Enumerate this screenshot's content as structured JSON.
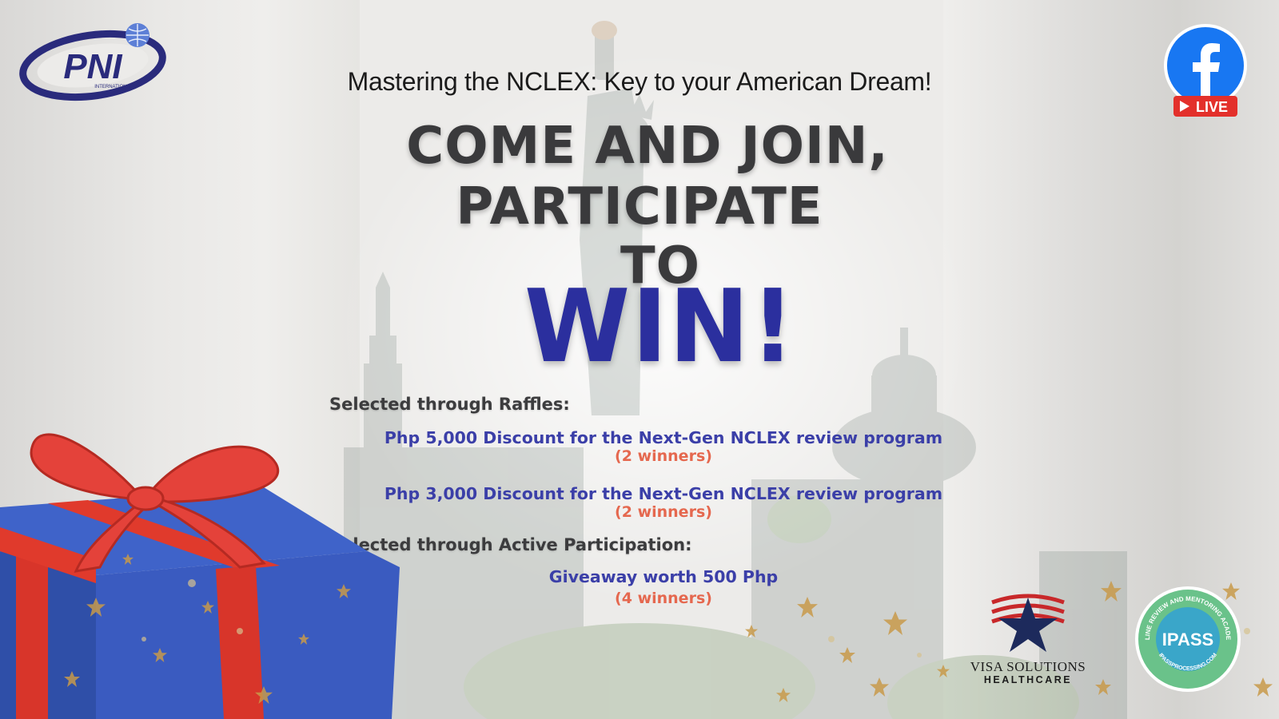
{
  "header": {
    "subtitle": "Mastering the NCLEX: Key to your American Dream!",
    "headline_line1": "COME AND JOIN,",
    "headline_line2": "PARTICIPATE",
    "headline_line3": "TO",
    "headline_win": "WIN!"
  },
  "logos": {
    "pni_text": "PNI",
    "pni_subtext": "INTERNATIONAL",
    "facebook_live_label": "LIVE",
    "visa_name": "VISA SOLUTIONS",
    "visa_sub": "HEALTHCARE",
    "ipass_text": "IPASS",
    "ipass_ring_top": "ONLINE REVIEW AND MENTORING ACADEMY",
    "ipass_ring_bottom": "IPASSPROCESSING.COM"
  },
  "prizes": {
    "raffles_heading": "Selected through Raffles:",
    "raffle_items": [
      {
        "label": "Php 5,000 Discount for the Next-Gen NCLEX review program",
        "winners": "(2 winners)"
      },
      {
        "label": "Php 3,000 Discount for the Next-Gen NCLEX review program",
        "winners": "(2 winners)"
      }
    ],
    "participation_heading": "Selected through Active Participation:",
    "participation_items": [
      {
        "label": "Giveaway worth 500 Php",
        "winners": "(4 winners)"
      }
    ]
  },
  "colors": {
    "headline_gray": "#3a3a3c",
    "win_blue": "#2b2f9e",
    "prize_blue": "#3b3fa8",
    "winners_coral": "#e5684f",
    "facebook_blue": "#1877f2",
    "live_red": "#e3302b"
  }
}
